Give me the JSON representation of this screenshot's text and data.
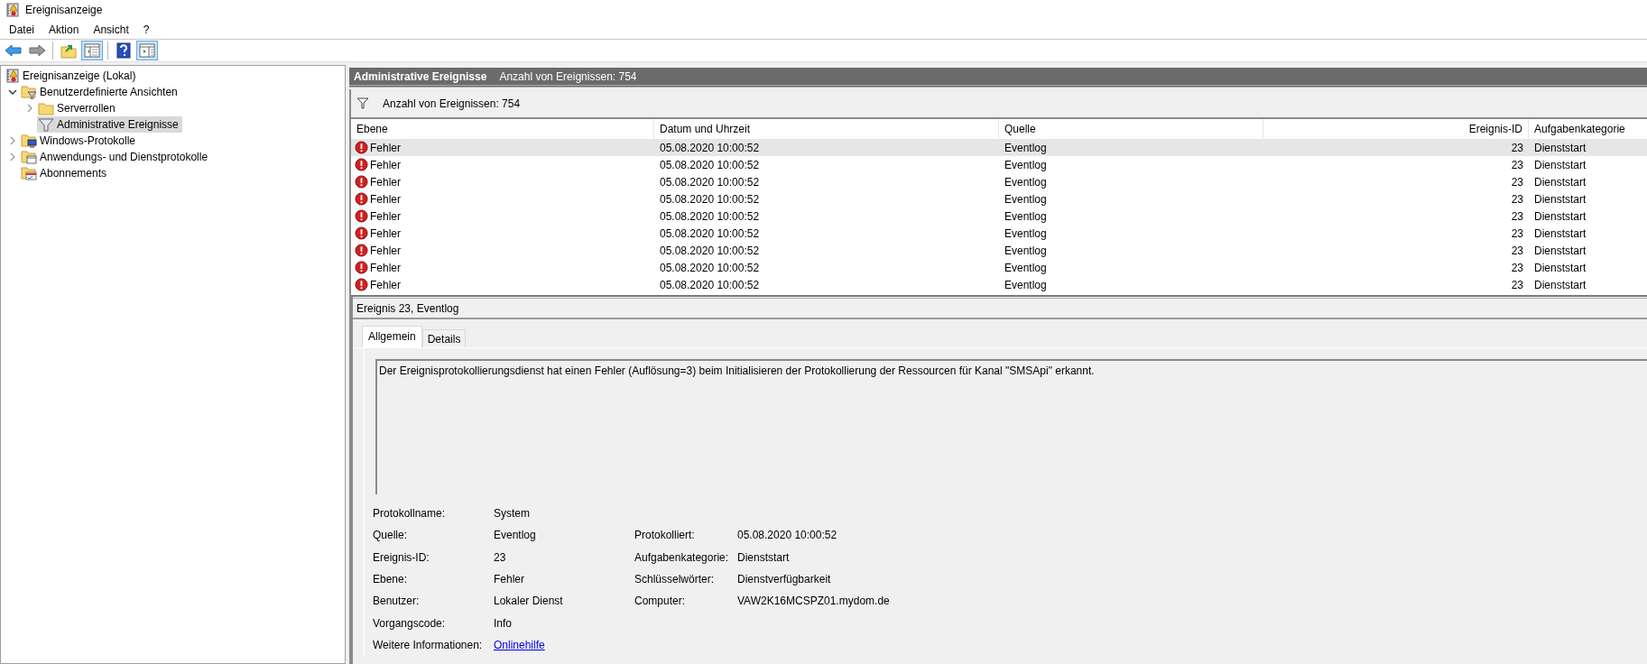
{
  "window": {
    "title": "Ereignisanzeige"
  },
  "menu": [
    "Datei",
    "Aktion",
    "Ansicht",
    "?"
  ],
  "toolbar": [
    [
      {
        "kind": "back",
        "pressed": false
      },
      {
        "kind": "forward",
        "pressed": false
      }
    ],
    [
      {
        "kind": "up",
        "pressed": false
      },
      {
        "kind": "tree-pane",
        "pressed": true
      }
    ],
    [
      {
        "kind": "help",
        "pressed": false
      },
      {
        "kind": "action-pane",
        "pressed": true
      }
    ]
  ],
  "tree": [
    {
      "label": "Ereignisanzeige (Lokal)",
      "kind": "root",
      "selected": false,
      "children": [
        {
          "label": "Benutzerdefinierte Ansichten",
          "kind": "filter-folder",
          "expanded": true,
          "selected": false,
          "children": [
            {
              "label": "Serverrollen",
              "kind": "folder",
              "expanded": false,
              "selected": false
            },
            {
              "label": "Administrative Ereignisse",
              "kind": "filter",
              "selected": true
            }
          ]
        },
        {
          "label": "Windows-Protokolle",
          "kind": "log-folder",
          "expanded": false,
          "selected": false
        },
        {
          "label": "Anwendungs- und Dienstprotokolle",
          "kind": "app-folder",
          "expanded": false,
          "selected": false
        },
        {
          "label": "Abonnements",
          "kind": "subscription",
          "selected": false
        }
      ]
    }
  ],
  "header": {
    "title": "Administrative Ereignisse",
    "count": "Anzahl von Ereignissen: 754"
  },
  "filter_bar": {
    "text": "Anzahl von Ereignissen: 754"
  },
  "table": {
    "columns": [
      {
        "label": "Ebene",
        "kind": "text"
      },
      {
        "label": "Datum und Uhrzeit",
        "kind": "text"
      },
      {
        "label": "Quelle",
        "kind": "text"
      },
      {
        "label": "Ereignis-ID",
        "kind": "number"
      },
      {
        "label": "Aufgabenkategorie",
        "kind": "text"
      }
    ],
    "rows": [
      {
        "kind": "error",
        "selected": true,
        "cells": [
          "Fehler",
          "05.08.2020 10:00:52",
          "Eventlog",
          "23",
          "Dienststart"
        ]
      },
      {
        "kind": "error",
        "selected": false,
        "cells": [
          "Fehler",
          "05.08.2020 10:00:52",
          "Eventlog",
          "23",
          "Dienststart"
        ]
      },
      {
        "kind": "error",
        "selected": false,
        "cells": [
          "Fehler",
          "05.08.2020 10:00:52",
          "Eventlog",
          "23",
          "Dienststart"
        ]
      },
      {
        "kind": "error",
        "selected": false,
        "cells": [
          "Fehler",
          "05.08.2020 10:00:52",
          "Eventlog",
          "23",
          "Dienststart"
        ]
      },
      {
        "kind": "error",
        "selected": false,
        "cells": [
          "Fehler",
          "05.08.2020 10:00:52",
          "Eventlog",
          "23",
          "Dienststart"
        ]
      },
      {
        "kind": "error",
        "selected": false,
        "cells": [
          "Fehler",
          "05.08.2020 10:00:52",
          "Eventlog",
          "23",
          "Dienststart"
        ]
      },
      {
        "kind": "error",
        "selected": false,
        "cells": [
          "Fehler",
          "05.08.2020 10:00:52",
          "Eventlog",
          "23",
          "Dienststart"
        ]
      },
      {
        "kind": "error",
        "selected": false,
        "cells": [
          "Fehler",
          "05.08.2020 10:00:52",
          "Eventlog",
          "23",
          "Dienststart"
        ]
      },
      {
        "kind": "error",
        "selected": false,
        "cells": [
          "Fehler",
          "05.08.2020 10:00:52",
          "Eventlog",
          "23",
          "Dienststart"
        ]
      }
    ]
  },
  "details": {
    "title": "Ereignis 23, Eventlog",
    "tabs": [
      {
        "label": "Allgemein",
        "selected": true
      },
      {
        "label": "Details",
        "selected": false
      }
    ],
    "description": "Der Ereignisprotokollierungsdienst hat einen Fehler (Auflösung=3) beim Initialisieren der Protokollierung der Ressourcen für Kanal \"SMSApi\" erkannt.",
    "properties": [
      {
        "left": {
          "label": "Protokollname:",
          "value": "System",
          "kind": "text"
        }
      },
      {
        "left": {
          "label": "Quelle:",
          "value": "Eventlog",
          "kind": "text"
        },
        "right": {
          "label": "Protokolliert:",
          "value": "05.08.2020 10:00:52"
        }
      },
      {
        "left": {
          "label": "Ereignis-ID:",
          "value": "23",
          "kind": "text"
        },
        "right": {
          "label": "Aufgabenkategorie:",
          "value": "Dienststart"
        }
      },
      {
        "left": {
          "label": "Ebene:",
          "value": "Fehler",
          "kind": "text"
        },
        "right": {
          "label": "Schlüsselwörter:",
          "value": "Dienstverfügbarkeit"
        }
      },
      {
        "left": {
          "label": "Benutzer:",
          "value": "Lokaler Dienst",
          "kind": "text"
        },
        "right": {
          "label": "Computer:",
          "value": "VAW2K16MCSPZ01.mydom.de"
        }
      },
      {
        "left": {
          "label": "Vorgangscode:",
          "value": "Info",
          "kind": "text"
        }
      },
      {
        "left": {
          "label": "Weitere Informationen:",
          "value": "Onlinehilfe",
          "kind": "link"
        }
      }
    ]
  }
}
